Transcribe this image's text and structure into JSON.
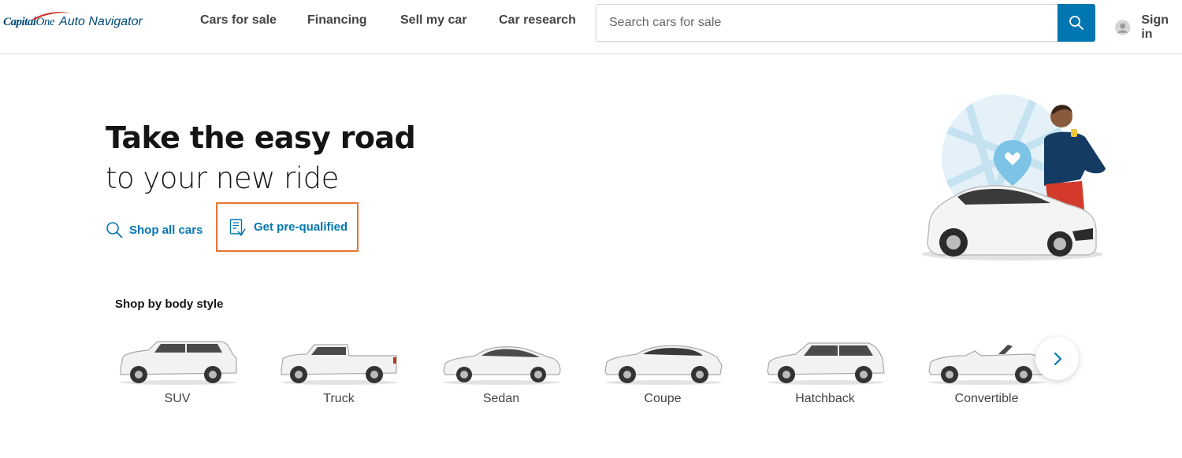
{
  "header": {
    "logo": {
      "brand": "Capital",
      "brand_one": "One",
      "product": "Auto Navigator"
    },
    "nav": [
      {
        "label": "Cars for sale"
      },
      {
        "label": "Financing"
      },
      {
        "label": "Sell my car"
      },
      {
        "label": "Car research"
      }
    ],
    "search": {
      "placeholder": "Search cars for sale",
      "value": "",
      "button_icon": "search-icon"
    },
    "signin": {
      "label": "Sign in",
      "icon": "user-avatar-icon"
    }
  },
  "hero": {
    "title": "Take the easy road",
    "subtitle": "to your new ride",
    "links": [
      {
        "label": "Shop all cars",
        "icon": "search-icon"
      },
      {
        "label": "Get pre-qualified",
        "icon": "document-check-icon",
        "highlighted": true
      }
    ]
  },
  "body_styles": {
    "title": "Shop by body style",
    "items": [
      {
        "label": "SUV",
        "icon": "suv-icon"
      },
      {
        "label": "Truck",
        "icon": "truck-icon"
      },
      {
        "label": "Sedan",
        "icon": "sedan-icon"
      },
      {
        "label": "Coupe",
        "icon": "coupe-icon"
      },
      {
        "label": "Hatchback",
        "icon": "hatchback-icon"
      },
      {
        "label": "Convertible",
        "icon": "convertible-icon"
      }
    ],
    "next_icon": "chevron-right-icon"
  },
  "colors": {
    "brand_blue": "#004977",
    "link_blue": "#0276b1",
    "highlight_orange": "#e87533",
    "logo_red": "#d03027"
  }
}
